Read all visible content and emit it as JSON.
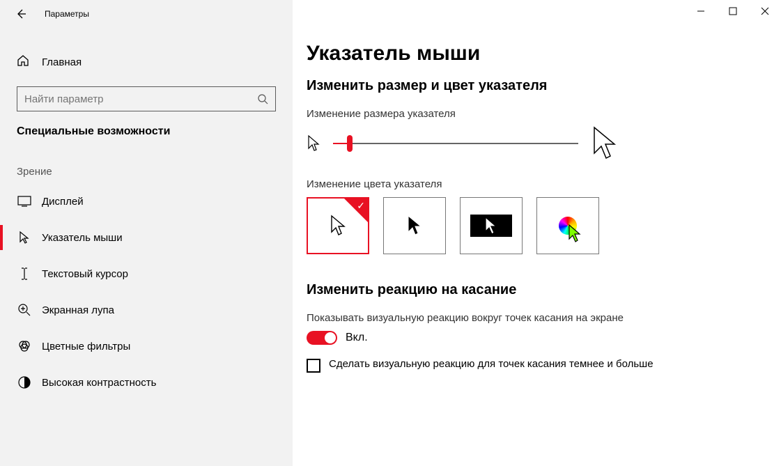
{
  "titlebar": {
    "app": "Параметры"
  },
  "sidebar": {
    "home": "Главная",
    "search_placeholder": "Найти параметр",
    "section": "Специальные возможности",
    "group": "Зрение",
    "items": [
      {
        "label": "Дисплей"
      },
      {
        "label": "Указатель мыши"
      },
      {
        "label": "Текстовый курсор"
      },
      {
        "label": "Экранная лупа"
      },
      {
        "label": "Цветные фильтры"
      },
      {
        "label": "Высокая контрастность"
      }
    ]
  },
  "main": {
    "title": "Указатель мыши",
    "section1": "Изменить размер и цвет указателя",
    "size_label": "Изменение размера указателя",
    "color_label": "Изменение цвета указателя",
    "section2": "Изменить реакцию на касание",
    "touch_desc": "Показывать визуальную реакцию вокруг точек касания на экране",
    "toggle_state": "Вкл.",
    "checkbox_label": "Сделать визуальную реакцию для точек касания темнее и больше"
  }
}
